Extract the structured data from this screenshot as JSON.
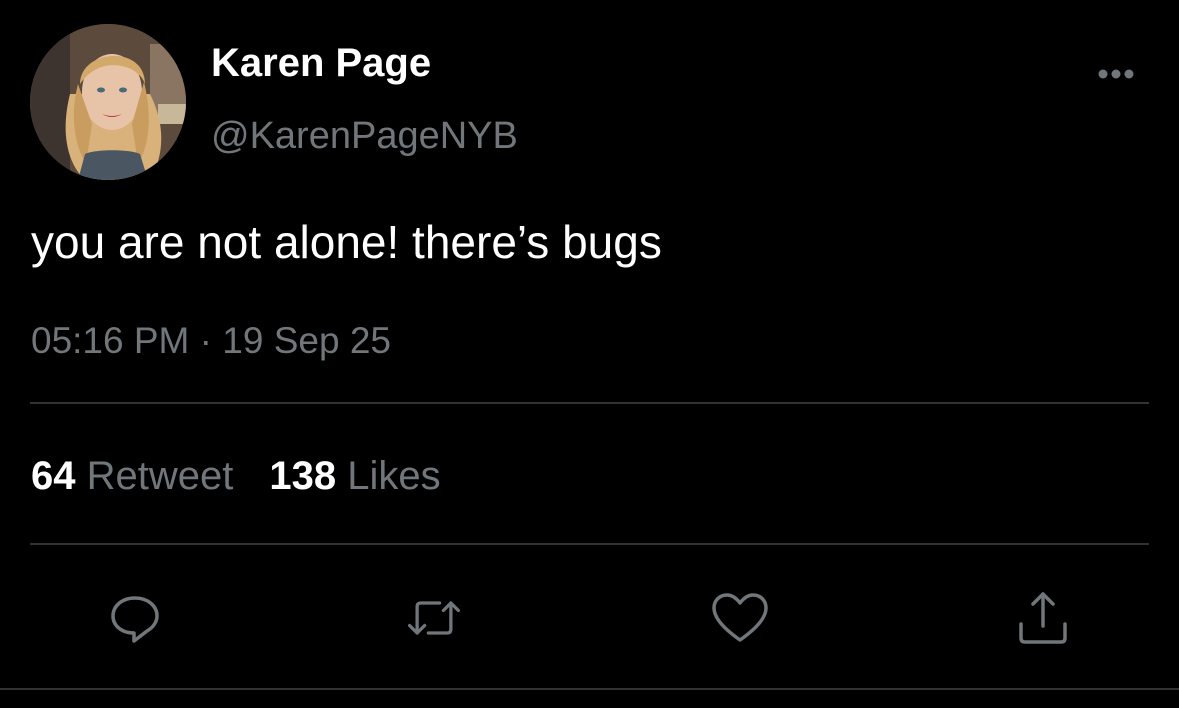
{
  "user": {
    "display_name": "Karen Page",
    "handle": "@KarenPageNYB",
    "avatar_icon": "profile-photo"
  },
  "tweet": {
    "text": "you are not alone! there’s bugs",
    "time": "05:16 PM",
    "separator": " · ",
    "date": "19 Sep 25"
  },
  "stats": {
    "retweets_count": "64",
    "retweets_label": "Retweet",
    "likes_count": "138",
    "likes_label": "Likes"
  },
  "actions": [
    {
      "name": "reply",
      "icon": "reply-icon"
    },
    {
      "name": "retweet",
      "icon": "retweet-icon"
    },
    {
      "name": "like",
      "icon": "heart-icon"
    },
    {
      "name": "share",
      "icon": "share-icon"
    }
  ],
  "colors": {
    "background": "#000000",
    "primary_text": "#ffffff",
    "secondary_text": "#71767b",
    "divider": "#2f3336"
  }
}
